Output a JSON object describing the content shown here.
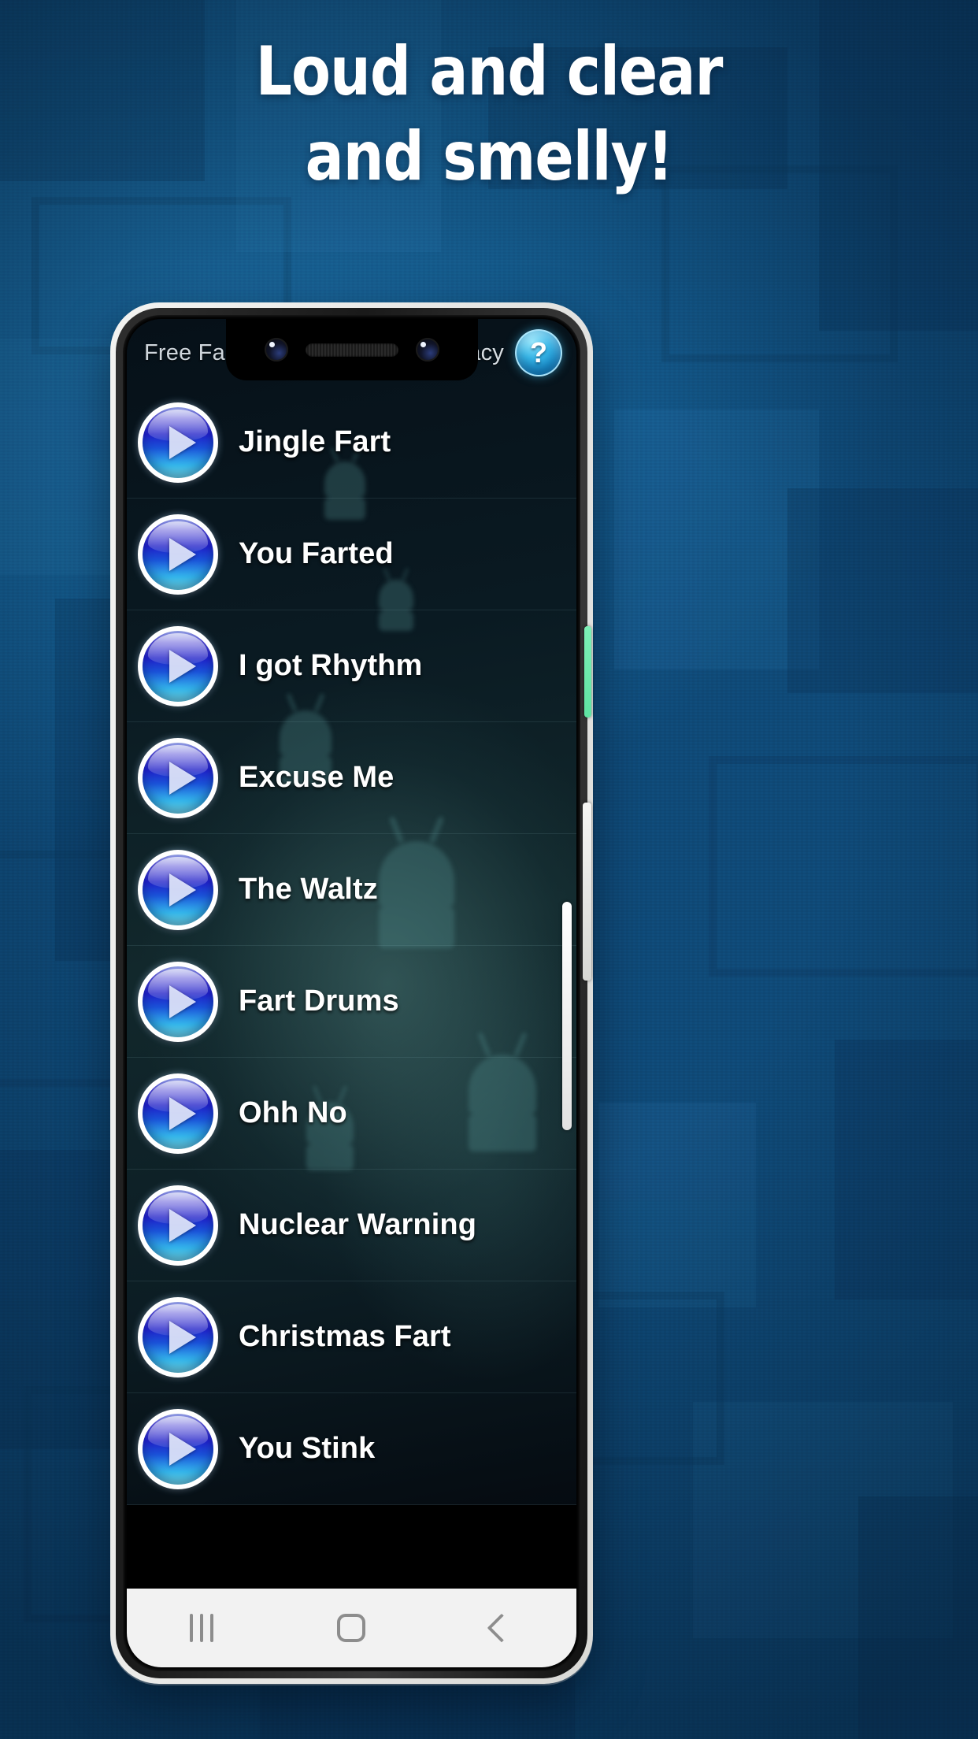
{
  "promo": {
    "headline_line1": "Loud and clear",
    "headline_line2": "and smelly!",
    "background_color": "#1a6ea8"
  },
  "app": {
    "title": "Free Fart Sounds",
    "privacy_label": "Privacy",
    "help_icon_label": "?",
    "accent_color": "#2bb3e6",
    "play_button_color": "#1f1fc8",
    "sounds": [
      {
        "label": "Jingle Fart"
      },
      {
        "label": "You Farted"
      },
      {
        "label": "I got Rhythm"
      },
      {
        "label": "Excuse Me"
      },
      {
        "label": "The Waltz"
      },
      {
        "label": "Fart Drums"
      },
      {
        "label": "Ohh No"
      },
      {
        "label": "Nuclear Warning"
      },
      {
        "label": "Christmas Fart"
      },
      {
        "label": "You Stink"
      }
    ]
  },
  "navbar": {
    "recents_label": "|||",
    "home_label": "home",
    "back_label": "<"
  },
  "device": {
    "power_button_color": "#6fe9ac",
    "volume_button_color": "#f0f0ee"
  }
}
